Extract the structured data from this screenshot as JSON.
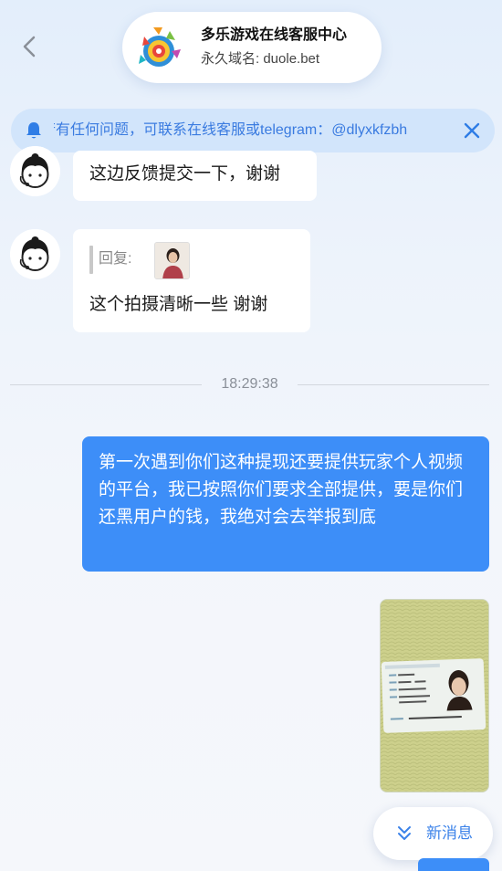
{
  "header": {
    "title": "多乐游戏在线客服中心",
    "domain": "永久域名: duole.bet"
  },
  "notice": {
    "text": "若有任何问题，可联系在线客服或telegram：@dlyxkfzbh"
  },
  "messages": {
    "msg1": "这边反馈提交一下，谢谢",
    "msg2_reply_label": "回复:",
    "msg2_text": "这个拍摄清晰一些   谢谢",
    "time": "18:29:38",
    "out1": "第一次遇到你们这种提现还要提供玩家个人视频的平台，我已按照你们要求全部提供，要是你们还黑用户的钱，我绝对会去举报到底"
  },
  "new_message_button": "新消息",
  "colors": {
    "accent": "#3d8ef8",
    "notice_bg": "#d2e5fb",
    "notice_text": "#3a7be0"
  }
}
